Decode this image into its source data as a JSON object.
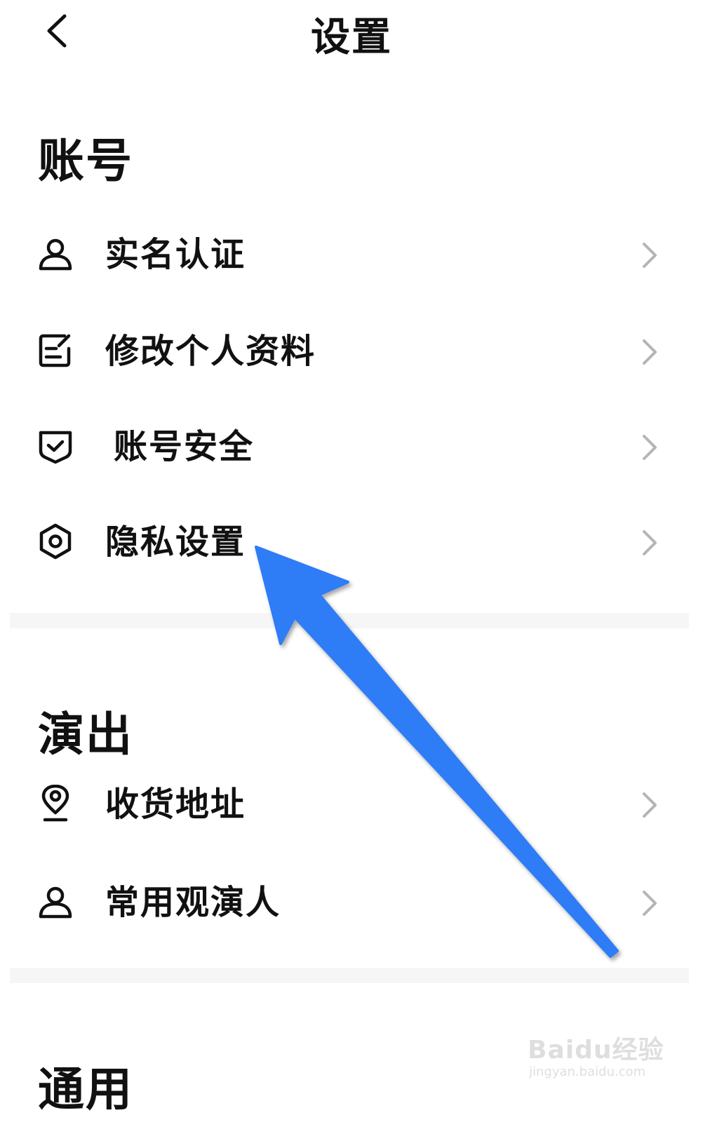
{
  "header": {
    "title": "设置",
    "back_icon": "chevron-left-icon"
  },
  "sections": {
    "account": {
      "title": "账号",
      "items": [
        {
          "label": "实名认证",
          "icon": "user-icon"
        },
        {
          "label": "修改个人资料",
          "icon": "edit-icon"
        },
        {
          "label": "账号安全",
          "icon": "shield-check-icon"
        },
        {
          "label": "隐私设置",
          "icon": "hexagon-settings-icon"
        }
      ]
    },
    "performance": {
      "title": "演出",
      "items": [
        {
          "label": "收货地址",
          "icon": "location-pin-icon"
        },
        {
          "label": "常用观演人",
          "icon": "user-icon"
        }
      ]
    },
    "general": {
      "title": "通用"
    }
  },
  "annotation": {
    "arrow_color": "#2f7cf6",
    "points_to": "隐私设置"
  },
  "watermark": {
    "brand": "Baidu经验",
    "url": "jingyan.baidu.com"
  },
  "colors": {
    "text": "#111111",
    "chevron": "#b5b5b5",
    "divider": "#f6f6f6"
  }
}
